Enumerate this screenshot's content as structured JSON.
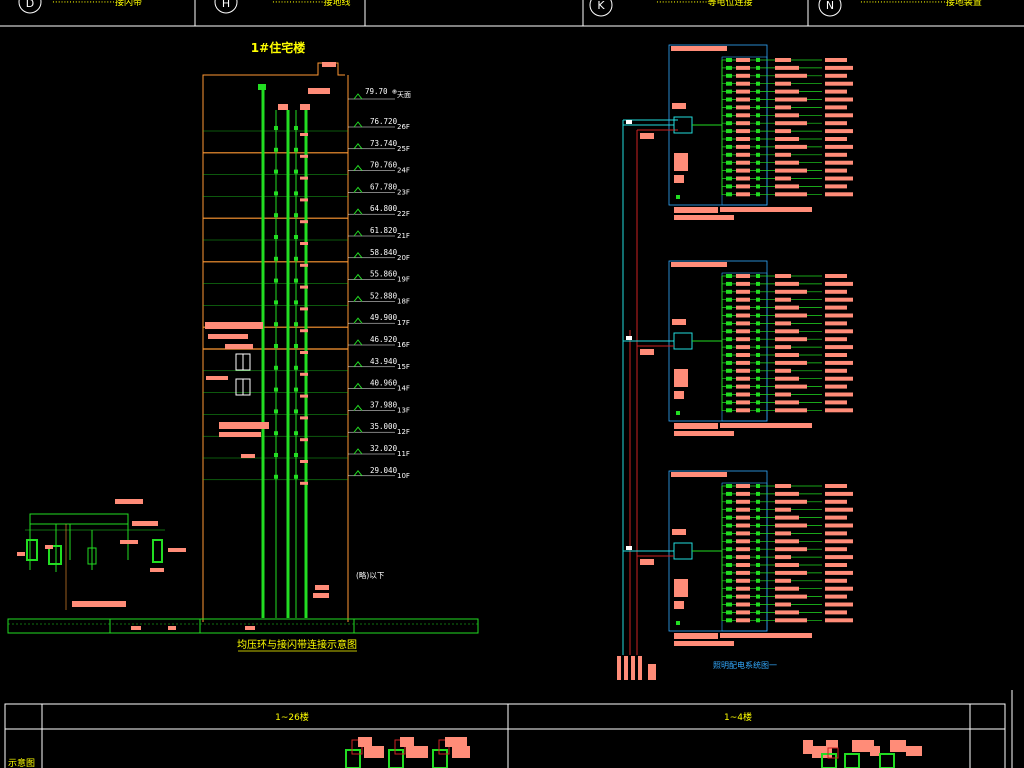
{
  "colors": {
    "background": "#000000",
    "frame": "#ffffff",
    "riser": "#22dd22",
    "floor_line": "#ff9933",
    "text_yellow": "#ffff00",
    "text_white": "#ffffff",
    "text_green": "#22dd22",
    "salmon_block": "#ff8c78",
    "panel_cyan": "#33aaff",
    "feeder_red": "#cc2222",
    "text_cyan": "#22dddd"
  },
  "header": {
    "grid_markers": [
      {
        "letter": "D",
        "caption": "······················接闪带"
      },
      {
        "letter": "H",
        "caption": "··················接地线"
      },
      {
        "letter": "K",
        "caption": "··················等电位连接"
      },
      {
        "letter": "N",
        "caption": "······························接地装置"
      }
    ]
  },
  "elevation": {
    "title": "1#住宅楼",
    "roof_level": "79.70 ⊕",
    "roof_label": "天面",
    "floors": [
      {
        "level": "76.720",
        "name": "26F"
      },
      {
        "level": "73.740",
        "name": "25F"
      },
      {
        "level": "70.760",
        "name": "24F"
      },
      {
        "level": "67.780",
        "name": "23F"
      },
      {
        "level": "64.800",
        "name": "22F"
      },
      {
        "level": "61.820",
        "name": "21F"
      },
      {
        "level": "58.840",
        "name": "20F"
      },
      {
        "level": "55.860",
        "name": "19F"
      },
      {
        "level": "52.880",
        "name": "18F"
      },
      {
        "level": "49.900",
        "name": "17F"
      },
      {
        "level": "46.920",
        "name": "16F"
      },
      {
        "level": "43.940",
        "name": "15F"
      },
      {
        "level": "40.960",
        "name": "14F"
      },
      {
        "level": "37.980",
        "name": "13F"
      },
      {
        "level": "35.000",
        "name": "12F"
      },
      {
        "level": "32.020",
        "name": "11F"
      },
      {
        "level": "29.040",
        "name": "10F"
      }
    ],
    "omit_note": "(略)以下",
    "caption": "均压环与接闪带连接示意图"
  },
  "distribution": {
    "caption": "照明配电系统图一",
    "panel_count": 3
  },
  "table": {
    "col1_header": "1~26楼",
    "col2_header": "1~4楼",
    "row_label": "示意图"
  }
}
